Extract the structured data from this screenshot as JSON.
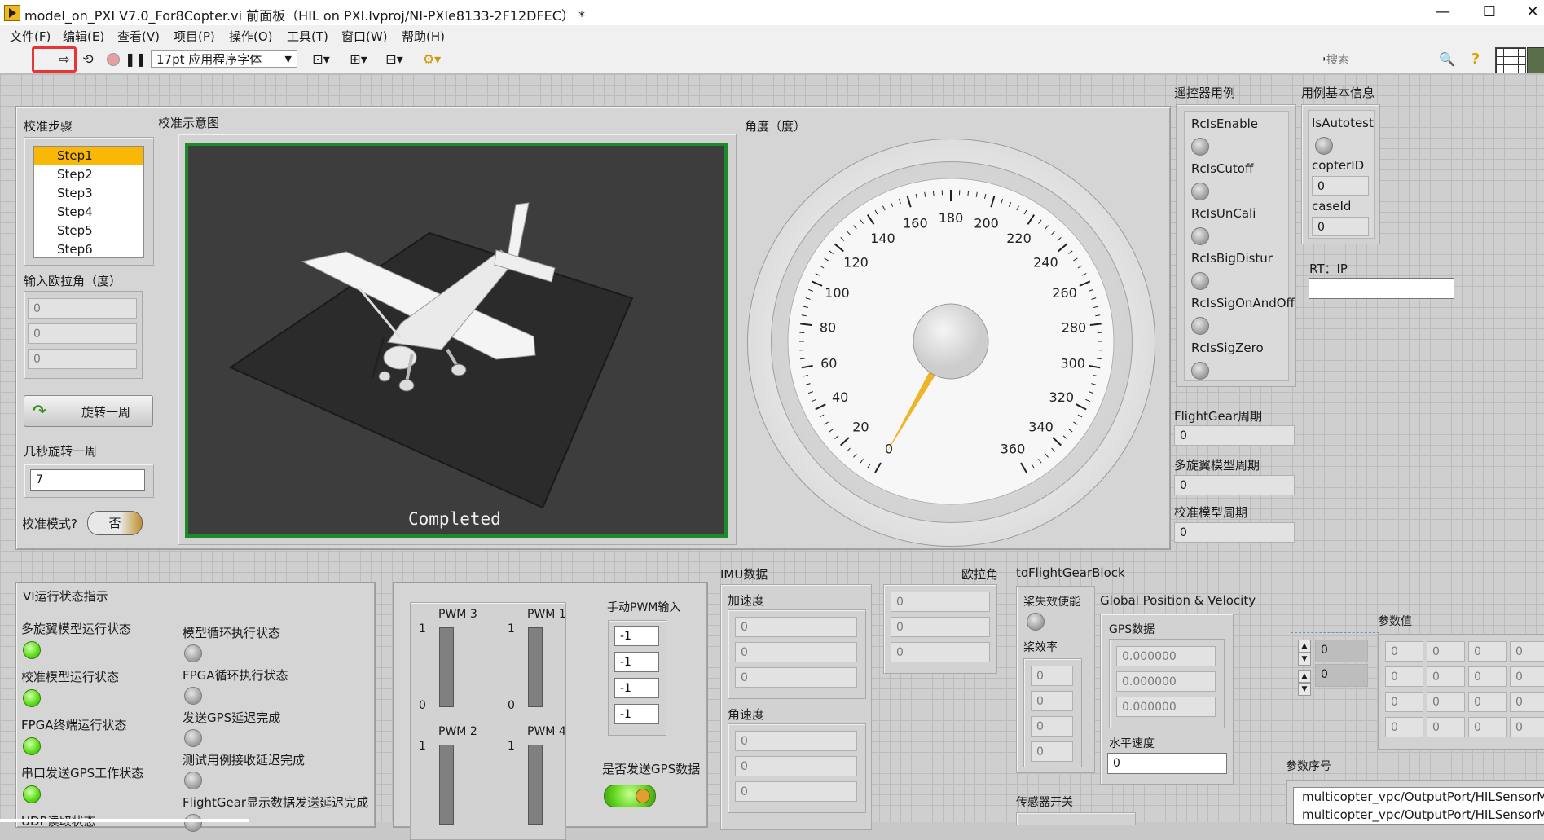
{
  "window": {
    "title": "model_on_PXI V7.0_For8Copter.vi 前面板（HIL on PXI.lvproj/NI-PXIe8133-2F12DFEC）  *",
    "minimize": "—",
    "maximize": "☐",
    "close": "✕"
  },
  "menu": [
    "文件(F)",
    "编辑(E)",
    "查看(V)",
    "项目(P)",
    "操作(O)",
    "工具(T)",
    "窗口(W)",
    "帮助(H)"
  ],
  "toolbar": {
    "font": "17pt 应用程序字体",
    "search_placeholder": "搜索",
    "help": "?"
  },
  "calib": {
    "steps_label": "校准步骤",
    "steps": [
      "Step1",
      "Step2",
      "Step3",
      "Step4",
      "Step5",
      "Step6"
    ],
    "selected_step": "Step1",
    "euler_label": "输入欧拉角（度）",
    "euler_values": [
      "0",
      "0",
      "0"
    ],
    "rotate_button": "旋转一周",
    "secs_label": "几秒旋转一周",
    "secs_value": "7",
    "mode_label": "校准模式?",
    "mode_value": "否",
    "diagram_label": "校准示意图",
    "scene_status": "Completed"
  },
  "gauge": {
    "label": "角度（度）",
    "ticks": [
      "0",
      "20",
      "40",
      "60",
      "80",
      "100",
      "120",
      "140",
      "160",
      "180",
      "200",
      "220",
      "240",
      "260",
      "280",
      "300",
      "320",
      "340",
      "360"
    ],
    "value": 0,
    "min": 0,
    "max": 360,
    "needle_color": "#f0b428"
  },
  "rc": {
    "label": "遥控器用例",
    "items": [
      "RcIsEnable",
      "RcIsCutoff",
      "RcIsUnCali",
      "RcIsBigDistur",
      "RcIsSigOnAndOff",
      "RcIsSigZero"
    ]
  },
  "basic": {
    "label": "用例基本信息",
    "auto_label": "IsAutotest",
    "copter_label": "copterID",
    "copter_value": "0",
    "case_label": "caseId",
    "case_value": "0"
  },
  "rt": {
    "label": "RT：IP",
    "value": ""
  },
  "periods": [
    {
      "label": "FlightGear周期",
      "value": "0"
    },
    {
      "label": "多旋翼模型周期",
      "value": "0"
    },
    {
      "label": "校准模型周期",
      "value": "0"
    }
  ],
  "vi_status": {
    "label": "VI运行状态指示",
    "left": [
      {
        "label": "多旋翼模型运行状态",
        "on": true
      },
      {
        "label": "校准模型运行状态",
        "on": true
      },
      {
        "label": "FPGA终端运行状态",
        "on": true
      },
      {
        "label": "串口发送GPS工作状态",
        "on": true
      },
      {
        "label": "UDP读取状态",
        "on": false
      }
    ],
    "right": [
      {
        "label": "模型循环执行状态",
        "on": false
      },
      {
        "label": "FPGA循环执行状态",
        "on": false
      },
      {
        "label": "发送GPS延迟完成",
        "on": false
      },
      {
        "label": "测试用例接收延迟完成",
        "on": false
      },
      {
        "label": "FlightGear显示数据发送延迟完成",
        "on": false
      }
    ]
  },
  "pwm": {
    "bars": [
      {
        "name": "PWM 3",
        "value": 0
      },
      {
        "name": "PWM 1",
        "value": 0
      },
      {
        "name": "PWM 2",
        "value": 0
      },
      {
        "name": "PWM 4",
        "value": 0
      }
    ],
    "scale_top": "1",
    "scale_bottom": "0",
    "manual_label": "手动PWM输入",
    "manual_values": [
      "-1",
      "-1",
      "-1",
      "-1"
    ],
    "gps_send_label": "是否发送GPS数据"
  },
  "imu": {
    "label": "IMU数据",
    "acc_label": "加速度",
    "acc": [
      "0",
      "0",
      "0"
    ],
    "gyro_label": "角速度",
    "gyro": [
      "0",
      "0",
      "0"
    ],
    "euler_label": "欧拉角",
    "euler": [
      "0",
      "0",
      "0"
    ]
  },
  "fg": {
    "label": "toFlightGearBlock",
    "prop_fail_label": "桨失效使能",
    "prop_eff_label": "桨效率",
    "prop_eff": [
      "0",
      "0",
      "0",
      "0"
    ],
    "sensor_label": "传感器开关"
  },
  "gpv": {
    "label": "Global Position & Velocity",
    "gps_label": "GPS数据",
    "gps": [
      "0.000000",
      "0.000000",
      "0.000000"
    ],
    "hspeed_label": "水平速度",
    "hspeed": "0"
  },
  "params": {
    "value_label": "参数值",
    "index_values": [
      "0",
      "0"
    ],
    "grid": [
      [
        "0",
        "0",
        "0",
        "0"
      ],
      [
        "0",
        "0",
        "0",
        "0"
      ],
      [
        "0",
        "0",
        "0",
        "0"
      ],
      [
        "0",
        "0",
        "0",
        "0"
      ]
    ],
    "seq_label": "参数序号",
    "seq_items": [
      "multicopter_vpc/OutputPort/HILSensorM",
      "multicopter_vpc/OutputPort/HILSensorM"
    ]
  }
}
